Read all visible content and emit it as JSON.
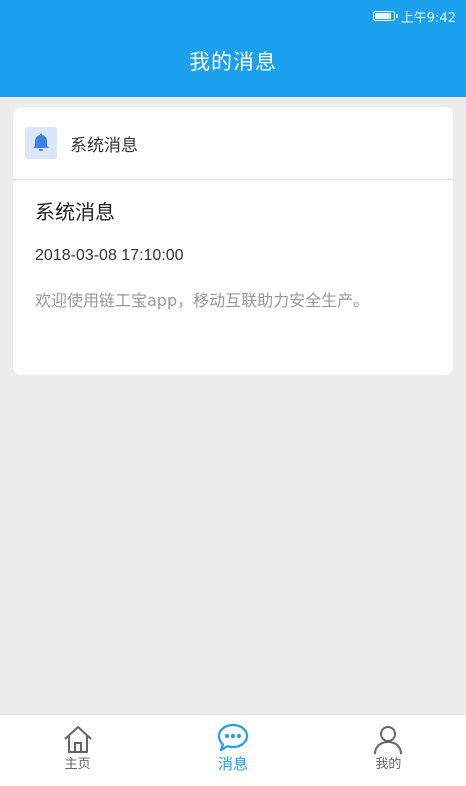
{
  "status_bar": {
    "time": "上午9:42"
  },
  "header": {
    "title": "我的消息"
  },
  "card": {
    "category_label": "系统消息",
    "message": {
      "title": "系统消息",
      "timestamp": "2018-03-08 17:10:00",
      "content": "欢迎使用链工宝app，移动互联助力安全生产。"
    }
  },
  "bottom_nav": {
    "items": [
      {
        "label": "主页",
        "icon": "home-icon",
        "active": false
      },
      {
        "label": "消息",
        "icon": "chat-icon",
        "active": true
      },
      {
        "label": "我的",
        "icon": "user-icon",
        "active": false
      }
    ]
  },
  "colors": {
    "primary": "#1aa0ec",
    "background": "#ececec",
    "card": "#ffffff",
    "muted_text": "#999999"
  }
}
